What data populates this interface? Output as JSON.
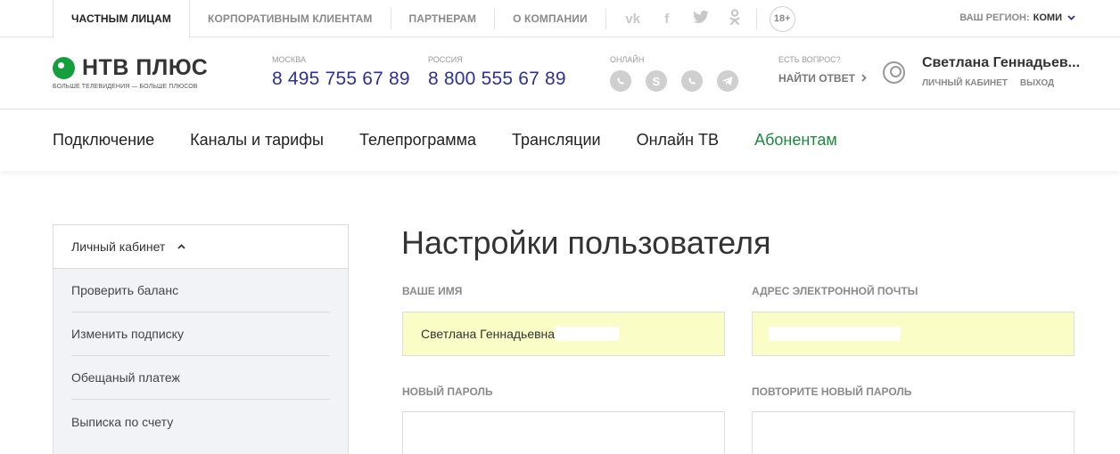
{
  "topbar": {
    "tabs": [
      "ЧАСТНЫМ ЛИЦАМ",
      "КОРПОРАТИВНЫМ КЛИЕНТАМ",
      "ПАРТНЕРАМ",
      "О КОМПАНИИ"
    ],
    "age": "18+",
    "region_label": "ВАШ РЕГИОН:",
    "region_value": "КОМИ"
  },
  "header": {
    "logo_text": "НТВ ПЛЮС",
    "logo_tagline": "БОЛЬШЕ ТЕЛЕВИДЕНИЯ — БОЛЬШЕ ПЛЮСОВ",
    "phone1_label": "МОСКВА",
    "phone1": "8 495 755 67 89",
    "phone2_label": "РОССИЯ",
    "phone2": "8 800 555 67 89",
    "online_label": "ОНЛАЙН",
    "question_label": "ЕСТЬ ВОПРОС?",
    "question_link": "НАЙТИ ОТВЕТ",
    "user_name": "Светлана Геннадьев...",
    "cabinet_link": "ЛИЧНЫЙ КАБИНЕТ",
    "logout_link": "ВЫХОД"
  },
  "mainnav": [
    "Подключение",
    "Каналы и тарифы",
    "Телепрограмма",
    "Трансляции",
    "Онлайн ТВ",
    "Абонентам"
  ],
  "sidebar": {
    "title": "Личный кабинет",
    "items": [
      "Проверить баланс",
      "Изменить подписку",
      "Обещаный платеж",
      "Выписка по счету"
    ]
  },
  "form": {
    "title": "Настройки пользователя",
    "name_label": "ВАШЕ ИМЯ",
    "name_value": "Светлана Геннадьевна",
    "email_label": "АДРЕС ЭЛЕКТРОННОЙ ПОЧТЫ",
    "email_value": "",
    "password_label": "НОВЫЙ ПАРОЛЬ",
    "password_value": "",
    "repeat_label": "ПОВТОРИТЕ НОВЫЙ ПАРОЛЬ",
    "repeat_value": ""
  },
  "colors": {
    "brand_green": "#159e3c",
    "phone_blue": "#2e3192",
    "autofill": "#fafdc6"
  }
}
